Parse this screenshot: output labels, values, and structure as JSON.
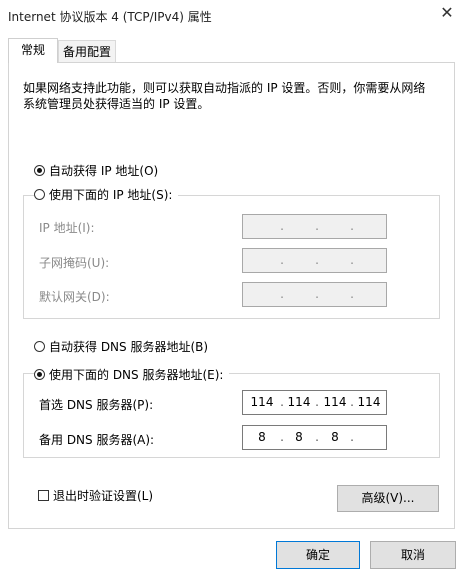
{
  "window": {
    "title": "Internet 协议版本 4 (TCP/IPv4) 属性",
    "close_icon": "✕"
  },
  "tabs": [
    {
      "label": "常规"
    },
    {
      "label": "备用配置"
    }
  ],
  "description": "如果网络支持此功能，则可以获取自动指派的 IP 设置。否则，你需要从网络系统管理员处获得适当的 IP 设置。",
  "ip_section": {
    "auto_label": "自动获得 IP 地址(O)",
    "manual_label": "使用下面的 IP 地址(S):",
    "auto_selected": true,
    "fields": [
      {
        "label": "IP 地址(I):",
        "octets": [
          "",
          "",
          "",
          ""
        ]
      },
      {
        "label": "子网掩码(U):",
        "octets": [
          "",
          "",
          "",
          ""
        ]
      },
      {
        "label": "默认网关(D):",
        "octets": [
          "",
          "",
          "",
          ""
        ]
      }
    ]
  },
  "dns_section": {
    "auto_label": "自动获得 DNS 服务器地址(B)",
    "manual_label": "使用下面的 DNS 服务器地址(E):",
    "manual_selected": true,
    "preferred": {
      "label": "首选 DNS 服务器(P):",
      "octets": [
        "114",
        "114",
        "114",
        "114"
      ]
    },
    "alternate": {
      "label": "备用 DNS 服务器(A):",
      "octets": [
        "8",
        "8",
        "8",
        ""
      ]
    }
  },
  "validate_on_exit": {
    "label": "退出时验证设置(L)",
    "checked": false
  },
  "buttons": {
    "advanced": "高级(V)...",
    "ok": "确定",
    "cancel": "取消"
  },
  "colors": {
    "accent_border": "#0078d7"
  }
}
